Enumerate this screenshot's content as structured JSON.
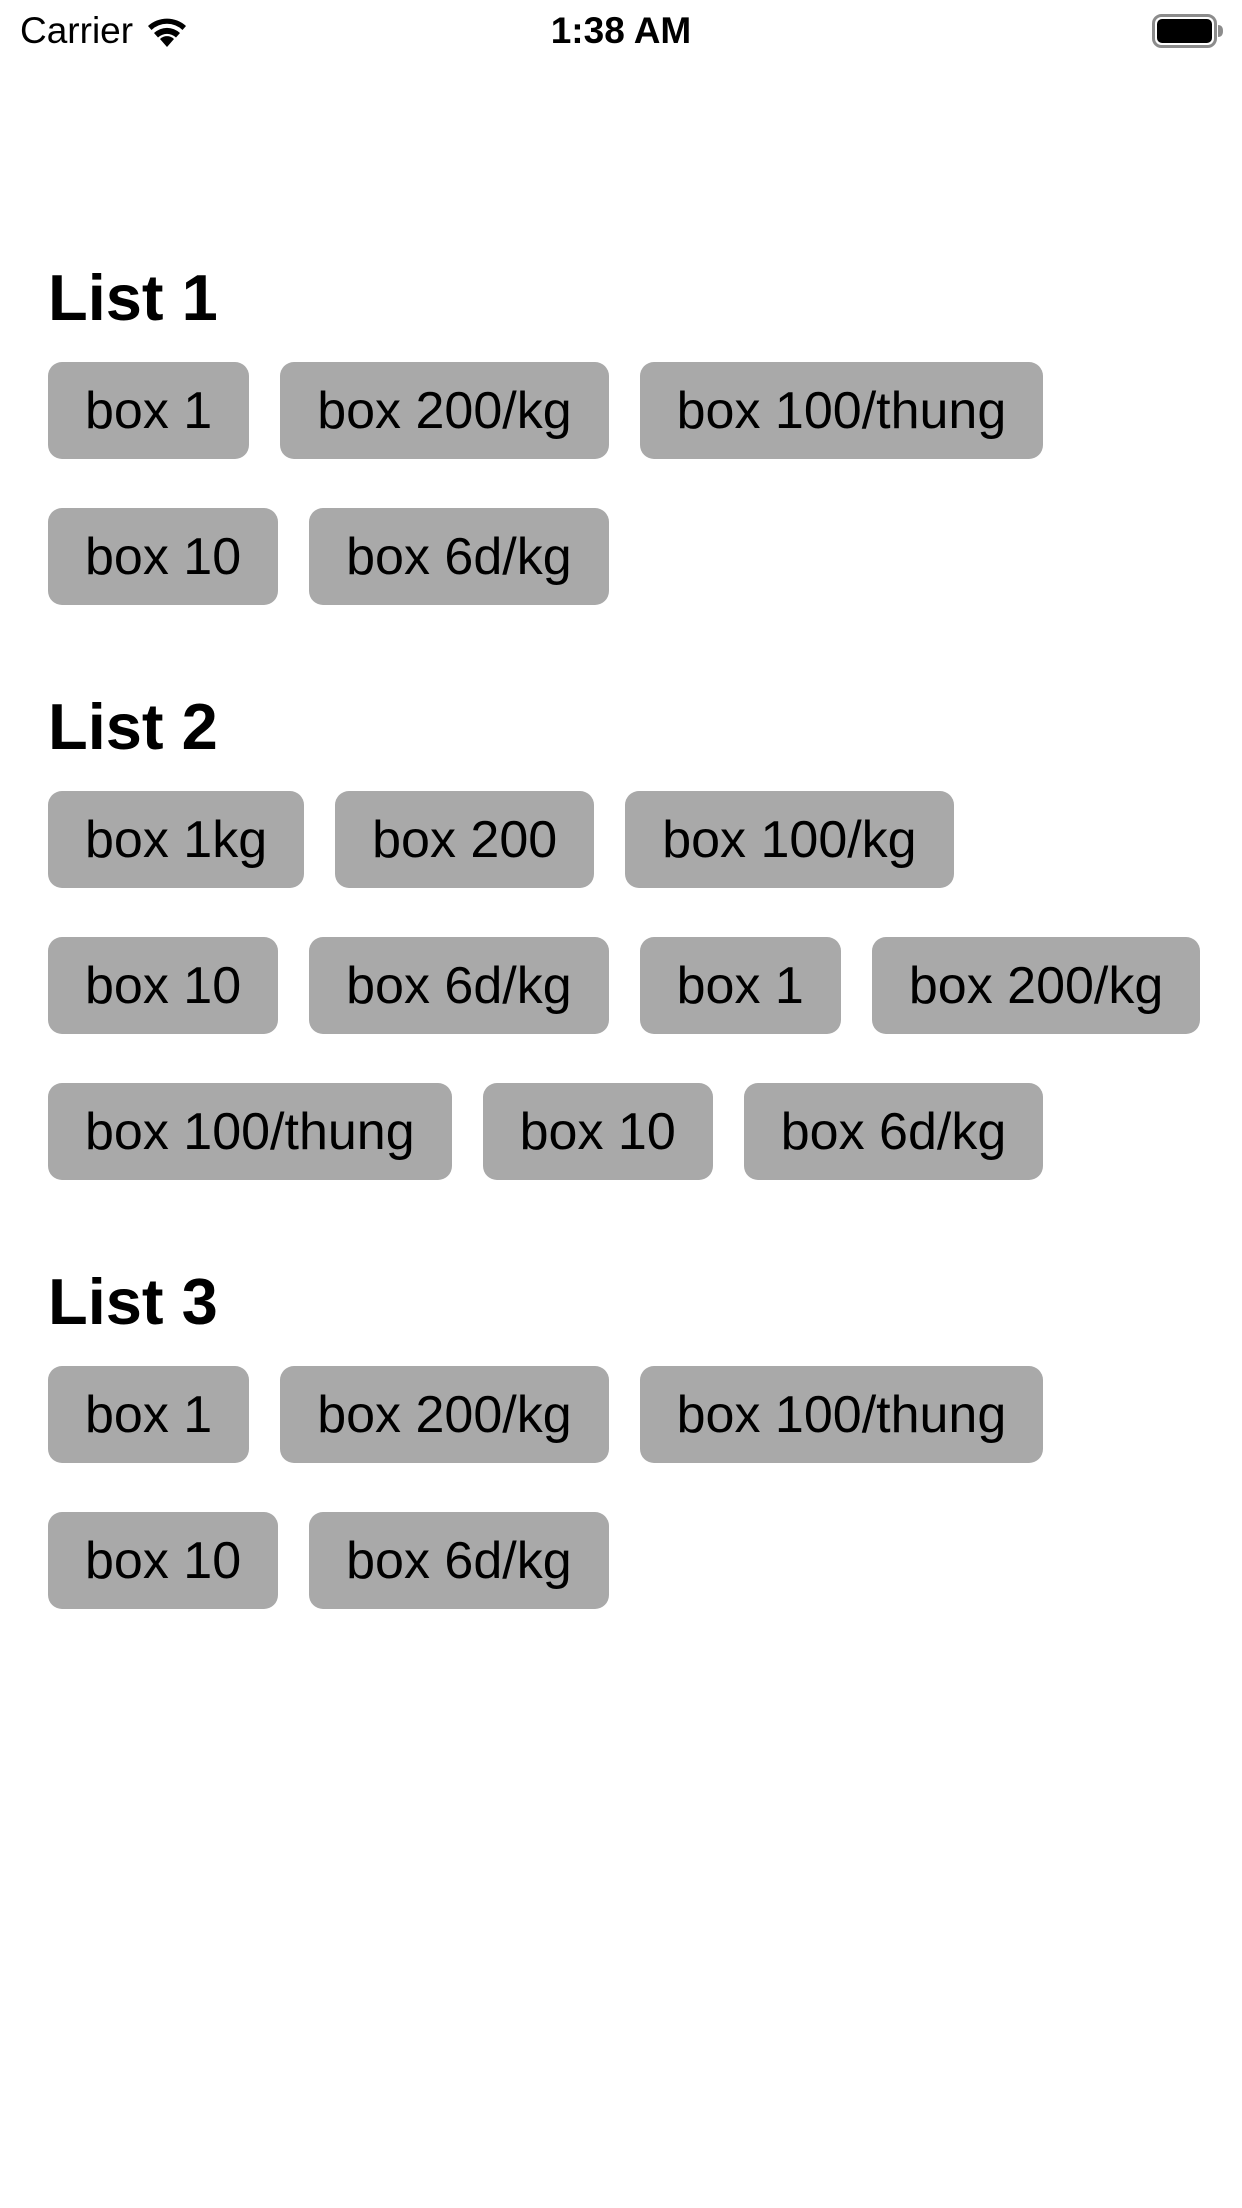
{
  "status_bar": {
    "carrier": "Carrier",
    "time": "1:38 AM",
    "wifi_icon": "wifi-icon",
    "battery_icon": "battery-icon"
  },
  "colors": {
    "chip_background": "#a9a9a9",
    "background": "#ffffff",
    "text": "#000000"
  },
  "lists": [
    {
      "title": "List 1",
      "items": [
        "box 1",
        "box 200/kg",
        "box 100/thung",
        "box 10",
        "box 6d/kg"
      ]
    },
    {
      "title": "List 2",
      "items": [
        "box 1kg",
        "box 200",
        "box 100/kg",
        "box 10",
        "box 6d/kg",
        "box 1",
        "box 200/kg",
        "box 100/thung",
        "box 10",
        "box 6d/kg"
      ]
    },
    {
      "title": "List 3",
      "items": [
        "box 1",
        "box 200/kg",
        "box 100/thung",
        "box 10",
        "box 6d/kg"
      ]
    }
  ]
}
